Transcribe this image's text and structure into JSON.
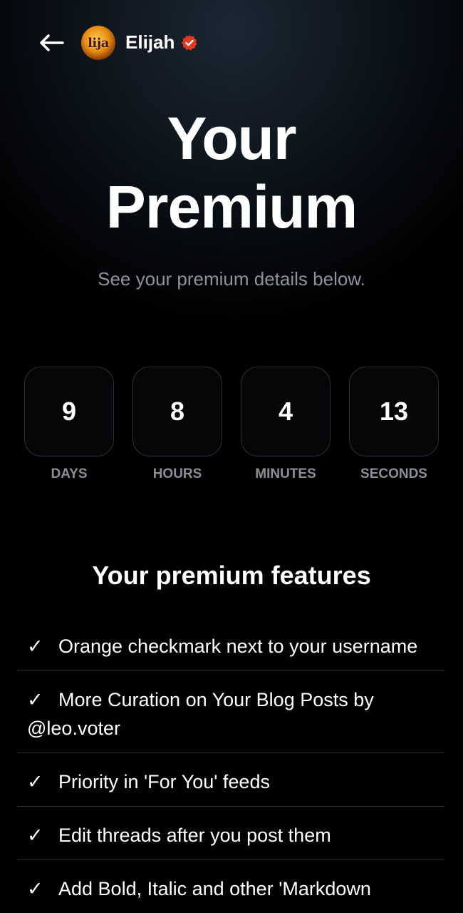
{
  "header": {
    "back_icon": "arrow-left-icon",
    "avatar_text": "lija",
    "username": "Elijah",
    "verified_badge_color": "#e0391f"
  },
  "hero": {
    "title_line1": "Your",
    "title_line2": "Premium",
    "subtitle": "See your premium details below."
  },
  "countdown": [
    {
      "value": "9",
      "label": "DAYS"
    },
    {
      "value": "8",
      "label": "HOURS"
    },
    {
      "value": "4",
      "label": "MINUTES"
    },
    {
      "value": "13",
      "label": "SECONDS"
    }
  ],
  "features": {
    "title": "Your premium features",
    "check_glyph": "✓",
    "items": [
      "Orange checkmark next to your username",
      "More Curation on Your Blog Posts by @leo.voter",
      "Priority in 'For You' feeds",
      "Edit threads after you post them",
      "Add Bold, Italic and other 'Markdown"
    ]
  }
}
